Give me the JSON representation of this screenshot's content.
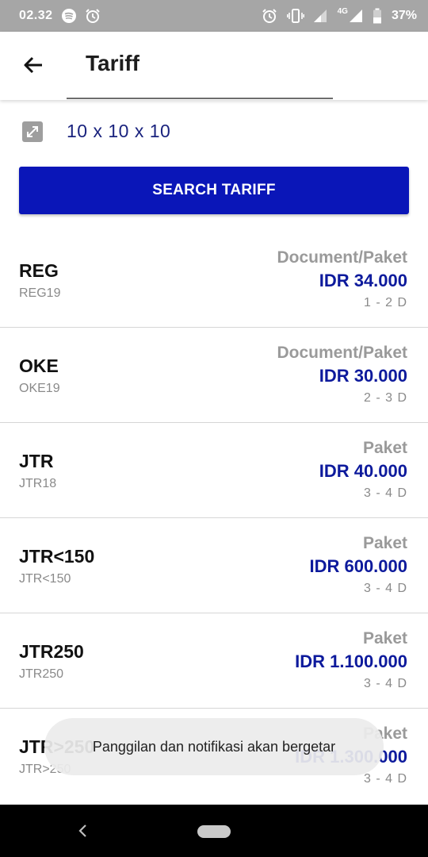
{
  "status_bar": {
    "time": "02.32",
    "network": "4G",
    "battery": "37%",
    "left_icons": [
      "spotify-icon",
      "alarm-icon"
    ],
    "right_icons": [
      "alarm-icon",
      "vibrate-icon",
      "signal-icon",
      "signal-4g-icon",
      "battery-icon"
    ]
  },
  "app_bar": {
    "title": "Tariff",
    "back_icon": "arrow-back-icon"
  },
  "dimension": {
    "icon": "resize-icon",
    "value": "10 x 10 x 10"
  },
  "search_button": {
    "label": "SEARCH TARIFF"
  },
  "tariffs": [
    {
      "name": "REG",
      "code": "REG19",
      "type": "Document/Paket",
      "price": "IDR 34.000",
      "eta": "1 - 2 D"
    },
    {
      "name": "OKE",
      "code": "OKE19",
      "type": "Document/Paket",
      "price": "IDR 30.000",
      "eta": "2 - 3 D"
    },
    {
      "name": "JTR",
      "code": "JTR18",
      "type": "Paket",
      "price": "IDR 40.000",
      "eta": "3 - 4 D"
    },
    {
      "name": "JTR<150",
      "code": "JTR<150",
      "type": "Paket",
      "price": "IDR 600.000",
      "eta": "3 - 4 D"
    },
    {
      "name": "JTR250",
      "code": "JTR250",
      "type": "Paket",
      "price": "IDR 1.100.000",
      "eta": "3 - 4 D"
    },
    {
      "name": "JTR>250",
      "code": "JTR>250",
      "type": "Paket",
      "price": "IDR 1.300.000",
      "eta": "3 - 4 D"
    }
  ],
  "toast": {
    "message": "Panggilan dan notifikasi akan bergetar"
  },
  "nav_bar": {
    "back_icon": "nav-back-icon",
    "home_icon": "nav-home-pill"
  },
  "colors": {
    "primary": "#0a16b8",
    "price": "#0d1a9c",
    "status_bar": "#a6a6a6"
  }
}
